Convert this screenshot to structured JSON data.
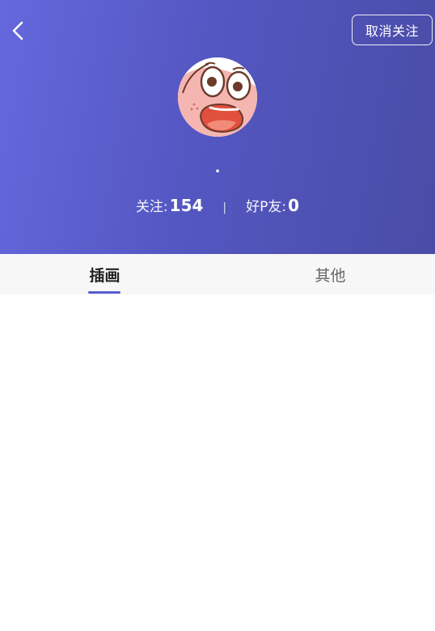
{
  "header": {
    "unfollow_label": "取消关注",
    "nickname": ".",
    "stats": {
      "following_label": "关注:",
      "following_value": "154",
      "divider": "|",
      "friends_label": "好P友:",
      "friends_value": "0"
    },
    "icons": {
      "back": "chevron-left-icon",
      "avatar": "patrick-star-avatar"
    },
    "gradient_colors": [
      "#6468dc",
      "#4a4ca6"
    ]
  },
  "tabs": {
    "items": [
      {
        "label": "插画",
        "active": true
      },
      {
        "label": "其他",
        "active": false
      }
    ],
    "accent_color": "#5a5ccc"
  }
}
